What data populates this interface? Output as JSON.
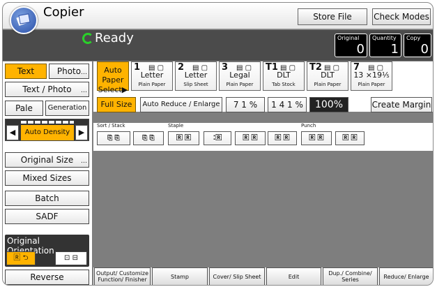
{
  "app": {
    "title": "Copier"
  },
  "toolbar": {
    "store_file_label": "Store File",
    "check_modes_label": "Check Modes"
  },
  "status": {
    "text": "Ready",
    "icon": "ready-icon",
    "counters": [
      {
        "label": "Original",
        "value": "0"
      },
      {
        "label": "Quantity",
        "value": "1"
      },
      {
        "label": "Copy",
        "value": "0"
      }
    ]
  },
  "left": {
    "text_label": "Text",
    "photo_label": "Photo",
    "text_photo_label": "Text / Photo",
    "pale_label": "Pale",
    "generation_label": "Generation",
    "density_label": "Auto Density",
    "original_size_label": "Original Size",
    "mixed_sizes_label": "Mixed Sizes",
    "batch_label": "Batch",
    "sadf_label": "SADF",
    "orientation_title": "Original Orientation",
    "reverse_orientation_label": "Reverse Orientation"
  },
  "paper": {
    "auto_select_label": "Auto Paper Select▶",
    "trays": [
      {
        "num": "1",
        "size": "Letter",
        "type": "Plain Paper"
      },
      {
        "num": "2",
        "size": "Letter",
        "type": "Slip Sheet"
      },
      {
        "num": "3",
        "size": "Legal",
        "type": "Plain Paper"
      },
      {
        "num": "T1",
        "size": "DLT",
        "type": "Tab Stock"
      },
      {
        "num": "T2",
        "size": "DLT",
        "type": "Plain Paper"
      },
      {
        "num": "7",
        "size": "13 ×19⅕",
        "type": "Plain Paper"
      }
    ]
  },
  "zoom": {
    "full_size_label": "Full Size",
    "auto_reduce_label": "Auto Reduce / Enlarge",
    "preset1": "7 1 %",
    "preset2": "1 4 1 %",
    "current": "100%",
    "create_margin_label": "Create Margin"
  },
  "finishing": {
    "sort_stack_label": "Sort / Stack",
    "staple_label": "Staple",
    "punch_label": "Punch"
  },
  "bottom": {
    "output_label": "Output/ Customize Function/ Finisher",
    "stamp_label": "Stamp",
    "cover_label": "Cover/ Slip Sheet",
    "edit_label": "Edit",
    "dup_label": "Dup./ Combine/ Series",
    "reduce_label": "Reduce/ Enlarge"
  },
  "colors": {
    "accent": "#ffb300",
    "status_bg": "#4b4b4b",
    "ready": "#2ad12a"
  }
}
